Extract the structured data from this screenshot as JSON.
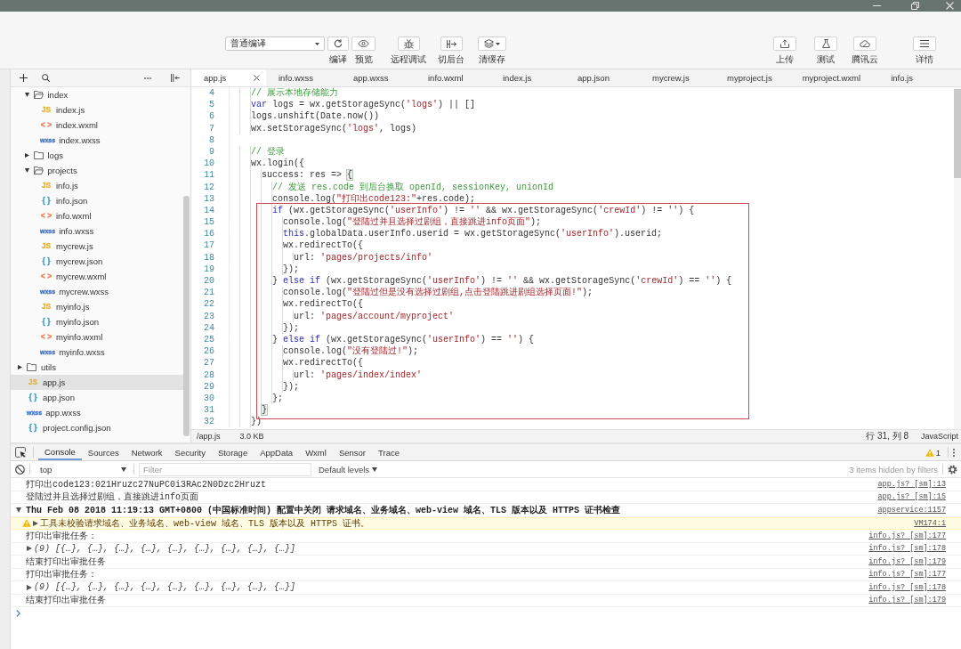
{
  "toolbar": {
    "compile_mode": "普通编译",
    "left_buttons": [
      {
        "label": "编译"
      },
      {
        "label": "预览"
      },
      {
        "label": "远程调试"
      },
      {
        "label": "切后台"
      },
      {
        "label": "清缓存"
      }
    ],
    "right_buttons": [
      {
        "label": "上传"
      },
      {
        "label": "测试"
      },
      {
        "label": "腾讯云"
      },
      {
        "label": "详情"
      }
    ]
  },
  "sidebar": {
    "tree": [
      {
        "kind": "offscreen",
        "children": [
          {
            "kind": "folder",
            "label": "index",
            "expanded": true,
            "selected": false,
            "children": [
              {
                "kind": "file",
                "label": "index.js",
                "badge": "JS",
                "color": "#e2b53e",
                "selected": false
              },
              {
                "kind": "file",
                "label": "index.wxml",
                "badge": "< >",
                "color": "#e07b53",
                "selected": false
              },
              {
                "kind": "file",
                "label": "index.wxss",
                "badge": "wxss",
                "color": "#3c74c4",
                "selected": false
              }
            ]
          },
          {
            "kind": "folder",
            "label": "logs",
            "expanded": false,
            "selected": false
          },
          {
            "kind": "folder",
            "label": "projects",
            "expanded": true,
            "selected": false,
            "children": [
              {
                "kind": "file",
                "label": "info.js",
                "badge": "JS",
                "color": "#e2b53e",
                "selected": false
              },
              {
                "kind": "file",
                "label": "info.json",
                "badge": "{ }",
                "color": "#3aa0c9",
                "selected": false
              },
              {
                "kind": "file",
                "label": "info.wxml",
                "badge": "< >",
                "color": "#e07b53",
                "selected": false
              },
              {
                "kind": "file",
                "label": "info.wxss",
                "badge": "wxss",
                "color": "#3c74c4",
                "selected": false
              },
              {
                "kind": "file",
                "label": "mycrew.js",
                "badge": "JS",
                "color": "#e2b53e",
                "selected": false
              },
              {
                "kind": "file",
                "label": "mycrew.json",
                "badge": "{ }",
                "color": "#3aa0c9",
                "selected": false
              },
              {
                "kind": "file",
                "label": "mycrew.wxml",
                "badge": "< >",
                "color": "#e07b53",
                "selected": false
              },
              {
                "kind": "file",
                "label": "mycrew.wxss",
                "badge": "wxss",
                "color": "#3c74c4",
                "selected": false
              },
              {
                "kind": "file",
                "label": "myinfo.js",
                "badge": "JS",
                "color": "#e2b53e",
                "selected": false
              },
              {
                "kind": "file",
                "label": "myinfo.json",
                "badge": "{ }",
                "color": "#3aa0c9",
                "selected": false
              },
              {
                "kind": "file",
                "label": "myinfo.wxml",
                "badge": "< >",
                "color": "#e07b53",
                "selected": false
              },
              {
                "kind": "file",
                "label": "myinfo.wxss",
                "badge": "wxss",
                "color": "#3c74c4",
                "selected": false
              }
            ]
          }
        ]
      },
      {
        "kind": "folder",
        "label": "utils",
        "expanded": false,
        "selected": false
      },
      {
        "kind": "file",
        "label": "app.js",
        "badge": "JS",
        "color": "#e2b53e",
        "selected": true
      },
      {
        "kind": "file",
        "label": "app.json",
        "badge": "{ }",
        "color": "#3aa0c9",
        "selected": false
      },
      {
        "kind": "file",
        "label": "app.wxss",
        "badge": "wxss",
        "color": "#3c74c4",
        "selected": false
      },
      {
        "kind": "file",
        "label": "project.config.json",
        "badge": "{ }",
        "color": "#3aa0c9",
        "selected": false
      }
    ]
  },
  "editor": {
    "tabs": [
      {
        "label": "app.js",
        "selected": true
      },
      {
        "label": "info.wxss",
        "selected": false
      },
      {
        "label": "app.wxss",
        "selected": false
      },
      {
        "label": "info.wxml",
        "selected": false
      },
      {
        "label": "index.js",
        "selected": false
      },
      {
        "label": "app.json",
        "selected": false
      },
      {
        "label": "mycrew.js",
        "selected": false
      },
      {
        "label": "myproject.js",
        "selected": false
      },
      {
        "label": "myproject.wxml",
        "selected": false
      },
      {
        "label": "info.js",
        "selected": false
      }
    ],
    "blocks": [
      {
        "boxed": false,
        "lines": [
          {
            "number": "4",
            "tokens": [
              {
                "kind": "comment",
                "text": "    // 展示本地存储能力"
              }
            ]
          },
          {
            "number": "5",
            "tokens": [
              {
                "kind": "keyword",
                "text": "    var"
              },
              {
                "kind": "plain",
                "text": " logs = wx.getStorageSync("
              },
              {
                "kind": "string",
                "text": "'logs'"
              },
              {
                "kind": "plain",
                "text": ") || []"
              }
            ]
          },
          {
            "number": "6",
            "tokens": [
              {
                "kind": "plain",
                "text": "    logs.unshift(Date.now())"
              }
            ]
          },
          {
            "number": "7",
            "tokens": [
              {
                "kind": "plain",
                "text": "    wx.setStorageSync("
              },
              {
                "kind": "string",
                "text": "'logs'"
              },
              {
                "kind": "plain",
                "text": ", logs)"
              }
            ]
          },
          {
            "number": "8"
          },
          {
            "number": "9",
            "tokens": [
              {
                "kind": "comment",
                "text": "    // 登录"
              }
            ]
          },
          {
            "number": "10",
            "tokens": [
              {
                "kind": "plain",
                "text": "    wx.login({"
              }
            ]
          },
          {
            "number": "11",
            "tokens": [
              {
                "kind": "plain",
                "text": "      success: res => "
              },
              {
                "kind": "match",
                "text": "{"
              }
            ]
          },
          {
            "number": "12",
            "tokens": [
              {
                "kind": "comment",
                "text": "        // 发送 res.code 到后台换取 openId, sessionKey, unionId"
              }
            ]
          },
          {
            "number": "13",
            "tokens": [
              {
                "kind": "plain",
                "text": "        console.log("
              },
              {
                "kind": "string",
                "text": "\"打印出code123:\""
              },
              {
                "kind": "plain",
                "text": "+res.code);"
              }
            ]
          }
        ]
      },
      {
        "boxed": true,
        "lines": [
          {
            "number": "14",
            "tokens": [
              {
                "kind": "keyword",
                "text": "        if"
              },
              {
                "kind": "plain",
                "text": " (wx.getStorageSync("
              },
              {
                "kind": "string",
                "text": "'userInfo'"
              },
              {
                "kind": "plain",
                "text": ") != "
              },
              {
                "kind": "string",
                "text": "''"
              },
              {
                "kind": "plain",
                "text": " && wx.getStorageSync("
              },
              {
                "kind": "string",
                "text": "'crewId'"
              },
              {
                "kind": "plain",
                "text": ") != "
              },
              {
                "kind": "string",
                "text": "''"
              },
              {
                "kind": "plain",
                "text": ") {"
              }
            ]
          },
          {
            "number": "15",
            "tokens": [
              {
                "kind": "plain",
                "text": "          console.log("
              },
              {
                "kind": "string",
                "text": "\"登陆过并且选择过剧组，直接跳进info页面\""
              },
              {
                "kind": "plain",
                "text": ");"
              }
            ]
          },
          {
            "number": "16",
            "tokens": [
              {
                "kind": "keyword",
                "text": "          this"
              },
              {
                "kind": "plain",
                "text": ".globalData.userInfo.userid = wx.getStorageSync("
              },
              {
                "kind": "string",
                "text": "'userInfo'"
              },
              {
                "kind": "plain",
                "text": ").userid;"
              }
            ]
          },
          {
            "number": "17",
            "tokens": [
              {
                "kind": "plain",
                "text": "          wx.redirectTo({"
              }
            ]
          },
          {
            "number": "18",
            "tokens": [
              {
                "kind": "plain",
                "text": "            url: "
              },
              {
                "kind": "string",
                "text": "'pages/projects/info'"
              }
            ]
          },
          {
            "number": "19",
            "tokens": [
              {
                "kind": "plain",
                "text": "          });"
              }
            ]
          },
          {
            "number": "20",
            "tokens": [
              {
                "kind": "plain",
                "text": "        } "
              },
              {
                "kind": "keyword",
                "text": "else if"
              },
              {
                "kind": "plain",
                "text": " (wx.getStorageSync("
              },
              {
                "kind": "string",
                "text": "'userInfo'"
              },
              {
                "kind": "plain",
                "text": ") != "
              },
              {
                "kind": "string",
                "text": "''"
              },
              {
                "kind": "plain",
                "text": " && wx.getStorageSync("
              },
              {
                "kind": "string",
                "text": "'crewId'"
              },
              {
                "kind": "plain",
                "text": ") == "
              },
              {
                "kind": "string",
                "text": "''"
              },
              {
                "kind": "plain",
                "text": ") {"
              }
            ]
          },
          {
            "number": "21",
            "tokens": [
              {
                "kind": "plain",
                "text": "          console.log("
              },
              {
                "kind": "string",
                "text": "\"登陆过但是没有选择过剧组,点击登陆跳进剧组选择页面!\""
              },
              {
                "kind": "plain",
                "text": ");"
              }
            ]
          },
          {
            "number": "22",
            "tokens": [
              {
                "kind": "plain",
                "text": "          wx.redirectTo({"
              }
            ]
          },
          {
            "number": "23",
            "tokens": [
              {
                "kind": "plain",
                "text": "            url: "
              },
              {
                "kind": "string",
                "text": "'pages/account/myproject'"
              }
            ]
          },
          {
            "number": "24",
            "tokens": [
              {
                "kind": "plain",
                "text": "          });"
              }
            ]
          },
          {
            "number": "25",
            "tokens": [
              {
                "kind": "plain",
                "text": "        } "
              },
              {
                "kind": "keyword",
                "text": "else if"
              },
              {
                "kind": "plain",
                "text": " (wx.getStorageSync("
              },
              {
                "kind": "string",
                "text": "'userInfo'"
              },
              {
                "kind": "plain",
                "text": ") == "
              },
              {
                "kind": "string",
                "text": "''"
              },
              {
                "kind": "plain",
                "text": ") {"
              }
            ]
          },
          {
            "number": "26",
            "tokens": [
              {
                "kind": "plain",
                "text": "          console.log("
              },
              {
                "kind": "string",
                "text": "\"没有登陆过!\""
              },
              {
                "kind": "plain",
                "text": ");"
              }
            ]
          },
          {
            "number": "27",
            "tokens": [
              {
                "kind": "plain",
                "text": "          wx.redirectTo({"
              }
            ]
          },
          {
            "number": "28",
            "tokens": [
              {
                "kind": "plain",
                "text": "            url: "
              },
              {
                "kind": "string",
                "text": "'pages/index/index'"
              }
            ]
          },
          {
            "number": "29",
            "tokens": [
              {
                "kind": "plain",
                "text": "          });"
              }
            ]
          },
          {
            "number": "30",
            "tokens": [
              {
                "kind": "plain",
                "text": "        };"
              }
            ]
          },
          {
            "number": "31",
            "tokens": [
              {
                "kind": "match",
                "text": "      }"
              }
            ]
          }
        ]
      },
      {
        "boxed": false,
        "lines": [
          {
            "number": "32",
            "tokens": [
              {
                "kind": "plain",
                "text": "    })"
              }
            ]
          }
        ]
      }
    ]
  },
  "status_bar": {
    "path": "/app.js",
    "size": "3.0 KB",
    "cursor": "行 31, 列 8",
    "language": "JavaScript"
  },
  "devtools": {
    "tabs": [
      {
        "label": "Console",
        "selected": true
      },
      {
        "label": "Sources",
        "selected": false
      },
      {
        "label": "Network",
        "selected": false
      },
      {
        "label": "Security",
        "selected": false
      },
      {
        "label": "Storage",
        "selected": false
      },
      {
        "label": "AppData",
        "selected": false
      },
      {
        "label": "Wxml",
        "selected": false
      },
      {
        "label": "Sensor",
        "selected": false
      },
      {
        "label": "Trace",
        "selected": false
      }
    ],
    "warning_count": "1",
    "context": "top",
    "filter": {
      "placeholder": "Filter"
    },
    "levels": "Default levels",
    "hidden_note": "3 items hidden by filters",
    "messages": [
      {
        "kind": "log",
        "text": "打印出code123:021Hruzc27NuPC0i3RAc2N0Dzc2Hruzt",
        "source": "app.js? [sm]:13"
      },
      {
        "kind": "log",
        "text": "登陆过并且选择过剧组，直接跳进info页面",
        "source": "app.js? [sm]:15"
      },
      {
        "kind": "group",
        "expanded": true,
        "text": "Thu Feb 08 2018 11:19:13 GMT+0800 (中国标准时间) 配置中关闭 请求域名、业务域名、web-view 域名、TLS 版本以及 HTTPS 证书检查",
        "source": "appservice:1157",
        "children": [
          {
            "kind": "warning",
            "expanded": false,
            "text": "工具未校验请求域名、业务域名、web-view 域名、TLS 版本以及 HTTPS 证书。",
            "source": "VM174:1"
          }
        ]
      },
      {
        "kind": "log",
        "text": "打印出审批任务：",
        "source": "info.js? [sm]:177"
      },
      {
        "kind": "array",
        "expanded": false,
        "text": "(9) [{…}, {…}, {…}, {…}, {…}, {…}, {…}, {…}, {…}]",
        "source": "info.js? [sm]:178"
      },
      {
        "kind": "log",
        "text": "结束打印出审批任务",
        "source": "info.js? [sm]:179"
      },
      {
        "kind": "log",
        "text": "打印出审批任务：",
        "source": "info.js? [sm]:177"
      },
      {
        "kind": "array",
        "expanded": false,
        "text": "(9) [{…}, {…}, {…}, {…}, {…}, {…}, {…}, {…}, {…}]",
        "source": "info.js? [sm]:178"
      },
      {
        "kind": "log",
        "text": "结束打印出审批任务",
        "source": "info.js? [sm]:179"
      }
    ]
  }
}
